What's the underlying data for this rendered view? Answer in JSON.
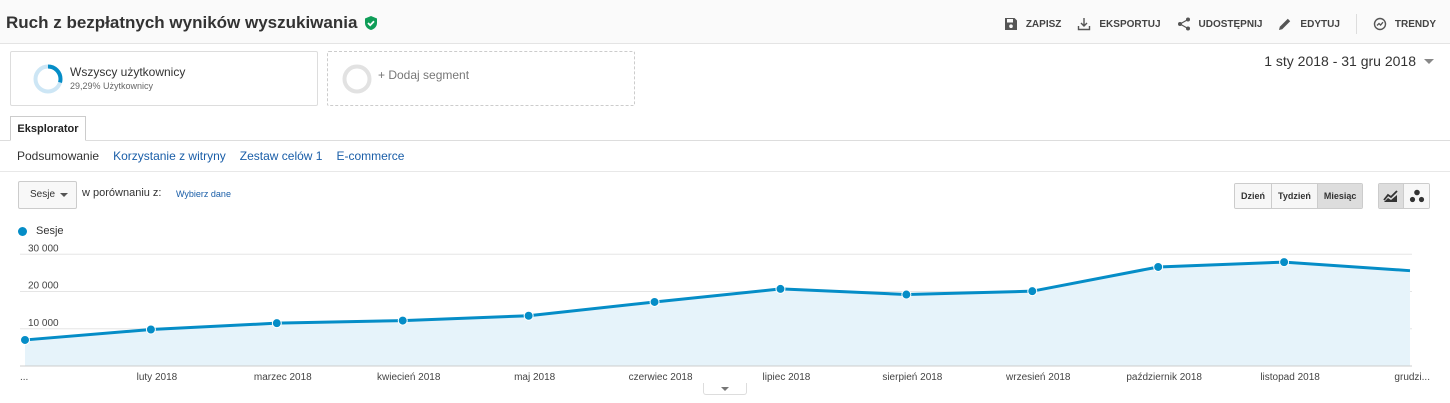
{
  "header": {
    "title": "Ruch z bezpłatnych wyników wyszukiwania",
    "actions": {
      "save": "ZAPISZ",
      "export": "EKSPORTUJ",
      "share": "UDOSTĘPNIJ",
      "edit": "EDYTUJ",
      "trends": "TRENDY"
    }
  },
  "segments": {
    "active": {
      "name": "Wszyscy użytkownicy",
      "sub": "29,29% Użytkownicy",
      "share": 29.29
    },
    "add_label": "+ Dodaj segment"
  },
  "date_range": "1 sty 2018 - 31 gru 2018",
  "tabs": {
    "explorer": "Eksplorator"
  },
  "subtabs": [
    "Podsumowanie",
    "Korzystanie z witryny",
    "Zestaw celów 1",
    "E-commerce"
  ],
  "controls": {
    "metric": "Sesje",
    "compare_label": "w porównaniu z:",
    "compare_link": "Wybierz dane",
    "periods": [
      "Dzień",
      "Tydzień",
      "Miesiąc"
    ],
    "active_period": "Miesiąc"
  },
  "colors": {
    "accent": "#058dc7",
    "area": "#e6f3fa",
    "verified": "#0f9d58",
    "link": "#1a5ea8"
  },
  "icons": [
    "check-shield-icon",
    "save-icon",
    "export-icon",
    "share-icon",
    "edit-icon",
    "trends-icon",
    "line-chart-icon",
    "motion-chart-icon"
  ],
  "chart_data": {
    "type": "area",
    "series": [
      {
        "name": "Sesje",
        "values": [
          7000,
          9800,
          11500,
          12200,
          13500,
          17200,
          20700,
          19200,
          20100,
          26600,
          27900,
          25600
        ]
      }
    ],
    "categories": [
      "...",
      "luty 2018",
      "marzec 2018",
      "kwiecień 2018",
      "maj 2018",
      "czerwiec 2018",
      "lipiec 2018",
      "sierpień 2018",
      "wrzesień 2018",
      "październik 2018",
      "listopad 2018",
      "grudzi..."
    ],
    "y_ticks": [
      "10 000",
      "20 000",
      "30 000"
    ],
    "ylim": [
      0,
      32500
    ],
    "grid": true,
    "legend": "top-left"
  }
}
